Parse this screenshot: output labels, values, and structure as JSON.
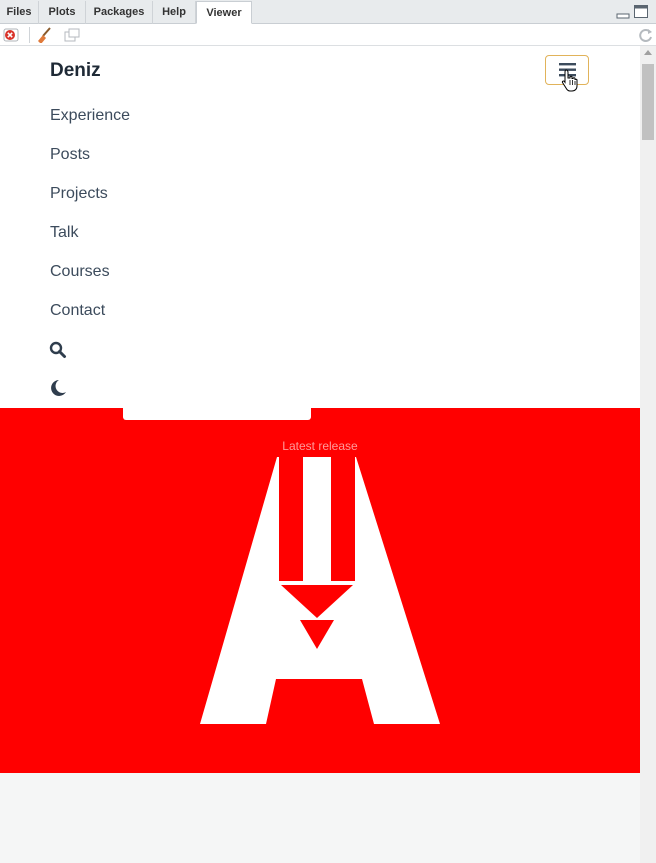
{
  "tabs": [
    {
      "label": "Files"
    },
    {
      "label": "Plots"
    },
    {
      "label": "Packages"
    },
    {
      "label": "Help"
    },
    {
      "label": "Viewer"
    }
  ],
  "nav": {
    "brand": "Deniz",
    "items": [
      {
        "label": "Experience"
      },
      {
        "label": "Posts"
      },
      {
        "label": "Projects"
      },
      {
        "label": "Talk"
      },
      {
        "label": "Courses"
      },
      {
        "label": "Contact"
      }
    ]
  },
  "hero": {
    "release_label": "Latest release",
    "background_color": "#ff0000"
  },
  "colors": {
    "brand_text": "#1f2a36",
    "nav_text": "#3c4b5c",
    "toggle_border": "#e1b35a"
  },
  "icons": [
    "close-viewer-icon",
    "broom-icon",
    "popout-icon",
    "refresh-icon",
    "hamburger-icon",
    "hand-cursor-icon",
    "search-icon",
    "moon-icon",
    "logo-icon"
  ]
}
